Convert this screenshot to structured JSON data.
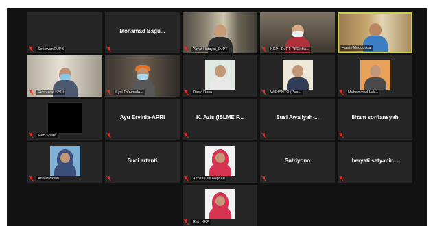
{
  "colors": {
    "stage_bg": "#121212",
    "tile_bg": "#262626",
    "active_speaker_border": "#c9d44a",
    "muted_icon": "#e0302a"
  },
  "icons": {
    "muted": "mic-muted-icon"
  },
  "participants": [
    {
      "id": "p1",
      "name": "Setiawan.DJPB",
      "display": "name-only",
      "muted": true
    },
    {
      "id": "p2",
      "name": "Mohamad Bagu...",
      "display": "center-name",
      "muted": true
    },
    {
      "id": "p3",
      "name": "Yayat Hidayat_DJPT",
      "display": "video",
      "muted": true
    },
    {
      "id": "p4",
      "name": "KKP - DJPT PSDI Ba...",
      "display": "video",
      "muted": true
    },
    {
      "id": "p5",
      "name": "Hawis Madduppa",
      "display": "video",
      "muted": false,
      "active": true
    },
    {
      "id": "p6",
      "name": "Direktorat KAPI",
      "display": "video",
      "muted": true
    },
    {
      "id": "p7",
      "name": "Syni Trikumala...",
      "display": "video",
      "muted": true
    },
    {
      "id": "p8",
      "name": "Rasyi Rosa",
      "display": "photo",
      "muted": true
    },
    {
      "id": "p9",
      "name": "WIDIANTO (Pus...",
      "display": "photo",
      "muted": true
    },
    {
      "id": "p10",
      "name": "Muhammad Luk...",
      "display": "photo",
      "muted": true
    },
    {
      "id": "p11",
      "name": "Meb Shara",
      "display": "black",
      "muted": true
    },
    {
      "id": "p12",
      "name": "Ayu Ervinia-APRI",
      "display": "center-name",
      "muted": true
    },
    {
      "id": "p13",
      "name": "K. Azis (ISLME P...",
      "display": "center-name",
      "muted": true
    },
    {
      "id": "p14",
      "name": "Susi Awaliyah-...",
      "display": "center-name",
      "muted": true
    },
    {
      "id": "p15",
      "name": "ilham sorfiansyah",
      "display": "center-name",
      "muted": true
    },
    {
      "id": "p16",
      "name": "Ana Rizayati",
      "display": "photo",
      "muted": true
    },
    {
      "id": "p17",
      "name": "Suci artanti",
      "display": "center-name",
      "muted": true
    },
    {
      "id": "p18",
      "name": "Annita Dwi Hapsari",
      "display": "photo",
      "muted": true
    },
    {
      "id": "p19",
      "name": "Sutriyono",
      "display": "center-name",
      "muted": true
    },
    {
      "id": "p20",
      "name": "heryati setyanin...",
      "display": "center-name",
      "muted": true
    },
    {
      "id": "p21",
      "name": "Rian KKP",
      "display": "photo",
      "muted": true
    }
  ]
}
